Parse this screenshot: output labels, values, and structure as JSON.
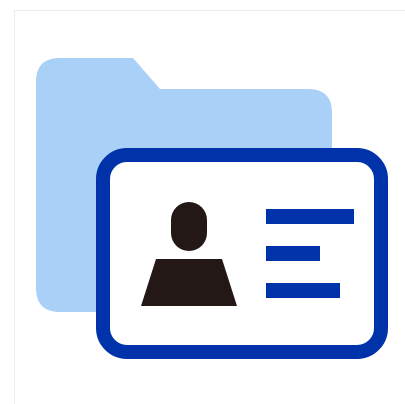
{
  "icon": {
    "name": "folder-contact-card-icon",
    "folder_color": "#a9d0f7",
    "card_border_color": "#0033aa",
    "card_fill_color": "#ffffff",
    "person_color": "#231815",
    "text_lines_color": "#0033aa"
  }
}
